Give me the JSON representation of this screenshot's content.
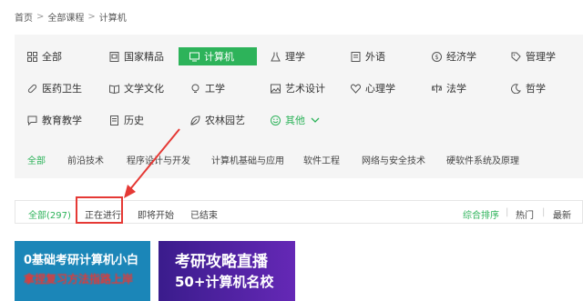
{
  "breadcrumb": {
    "home": "首页",
    "separator": ">",
    "all_courses": "全部课程",
    "current": "计算机"
  },
  "categories": {
    "row1": [
      {
        "label": "全部",
        "icon": "grid-icon"
      },
      {
        "label": "国家精品",
        "icon": "badge-icon"
      },
      {
        "label": "计算机",
        "icon": "monitor-icon",
        "active": true
      },
      {
        "label": "理学",
        "icon": "flask-icon"
      },
      {
        "label": "外语",
        "icon": "book-icon"
      },
      {
        "label": "经济学",
        "icon": "coin-icon"
      },
      {
        "label": "管理学",
        "icon": "tag-icon"
      }
    ],
    "row2": [
      {
        "label": "医药卫生",
        "icon": "pill-icon"
      },
      {
        "label": "文学文化",
        "icon": "open-book-icon"
      },
      {
        "label": "工学",
        "icon": "bulb-icon"
      },
      {
        "label": "艺术设计",
        "icon": "image-icon"
      },
      {
        "label": "心理学",
        "icon": "heart-icon"
      },
      {
        "label": "法学",
        "icon": "scale-icon"
      },
      {
        "label": "哲学",
        "icon": "moon-icon"
      }
    ],
    "row3": [
      {
        "label": "教育教学",
        "icon": "chat-icon"
      },
      {
        "label": "历史",
        "icon": "doc-icon"
      },
      {
        "label": "农林园艺",
        "icon": "leaf-icon"
      },
      {
        "label": "其他",
        "icon": "smile-icon",
        "chevron": "chevron-down-icon"
      }
    ]
  },
  "subtabs": [
    "全部",
    "前沿技术",
    "程序设计与开发",
    "计算机基础与应用",
    "软件工程",
    "网络与安全技术",
    "硬软件系统及原理"
  ],
  "filter": {
    "all": "全部(297)",
    "ongoing": "正在进行",
    "upcoming": "即将开始",
    "ended": "已结束",
    "sort_default": "综合排序",
    "divider": "|",
    "sort_hot": "热门",
    "sort_new": "最新"
  },
  "banners": {
    "b1_line1": "0基础考研计算机小白",
    "b1_line2": "拿捏复习方法指路上岸",
    "b2_line1": "考研攻略直播",
    "b2_line2": "50+计算机名校"
  },
  "colors": {
    "accent": "#2db35a",
    "annotation": "#e53935"
  }
}
